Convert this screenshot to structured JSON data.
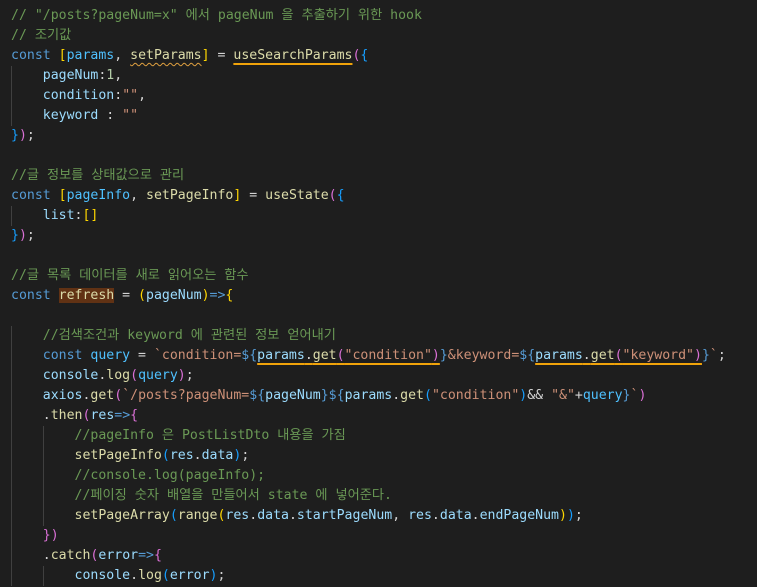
{
  "colors": {
    "background": "#1e1e1e",
    "highlight_underline": "#f0a30a",
    "squiggle": "#e0a040",
    "selection": "#613214"
  },
  "code_lines": [
    {
      "indent": 0,
      "tokens": [
        [
          "// \"/posts?pageNum=x\" 에서 pageNum 을 추출하기 위한 hook",
          "#6a9955"
        ]
      ]
    },
    {
      "indent": 0,
      "tokens": [
        [
          "// 조기값",
          "#6a9955"
        ]
      ]
    },
    {
      "indent": 0,
      "tokens": [
        [
          "const ",
          "#569cd6"
        ],
        [
          "[",
          "#ffd700"
        ],
        [
          "params",
          "#4fc1ff"
        ],
        [
          ", ",
          "#d4d4d4"
        ],
        [
          "setParams",
          "#dcdcaa",
          "squig"
        ],
        [
          "]",
          "#ffd700"
        ],
        [
          " = ",
          "#d4d4d4"
        ],
        [
          "useSearchParams",
          "#dcdcaa",
          "hl"
        ],
        [
          "(",
          "#da70d6"
        ],
        [
          "{",
          "#179fff"
        ]
      ]
    },
    {
      "indent": 1,
      "tokens": [
        [
          "pageNum",
          "#9cdcfe"
        ],
        [
          ":",
          "#d4d4d4"
        ],
        [
          "1",
          "#b5cea8"
        ],
        [
          ",",
          "#d4d4d4"
        ]
      ]
    },
    {
      "indent": 1,
      "tokens": [
        [
          "condition",
          "#9cdcfe"
        ],
        [
          ":",
          "#d4d4d4"
        ],
        [
          "\"\"",
          "#ce9178"
        ],
        [
          ",",
          "#d4d4d4"
        ]
      ]
    },
    {
      "indent": 1,
      "tokens": [
        [
          "keyword",
          "#9cdcfe"
        ],
        [
          " : ",
          "#d4d4d4"
        ],
        [
          "\"\"",
          "#ce9178"
        ]
      ]
    },
    {
      "indent": 0,
      "tokens": [
        [
          "}",
          "#179fff"
        ],
        [
          ")",
          "#da70d6"
        ],
        [
          ";",
          "#d4d4d4"
        ]
      ]
    },
    {
      "indent": 0,
      "tokens": []
    },
    {
      "indent": 0,
      "tokens": [
        [
          "//글 정보를 상태값으로 관리",
          "#6a9955"
        ]
      ]
    },
    {
      "indent": 0,
      "tokens": [
        [
          "const ",
          "#569cd6"
        ],
        [
          "[",
          "#ffd700"
        ],
        [
          "pageInfo",
          "#4fc1ff"
        ],
        [
          ", ",
          "#d4d4d4"
        ],
        [
          "setPageInfo",
          "#dcdcaa"
        ],
        [
          "]",
          "#ffd700"
        ],
        [
          " = ",
          "#d4d4d4"
        ],
        [
          "useState",
          "#dcdcaa"
        ],
        [
          "(",
          "#da70d6"
        ],
        [
          "{",
          "#179fff"
        ]
      ]
    },
    {
      "indent": 1,
      "tokens": [
        [
          "list",
          "#9cdcfe"
        ],
        [
          ":",
          "#d4d4d4"
        ],
        [
          "[]",
          "#ffd700"
        ]
      ]
    },
    {
      "indent": 0,
      "tokens": [
        [
          "}",
          "#179fff"
        ],
        [
          ")",
          "#da70d6"
        ],
        [
          ";",
          "#d4d4d4"
        ]
      ]
    },
    {
      "indent": 0,
      "tokens": []
    },
    {
      "indent": 0,
      "tokens": [
        [
          "//글 목록 데이터를 새로 읽어오는 함수",
          "#6a9955"
        ]
      ]
    },
    {
      "indent": 0,
      "tokens": [
        [
          "const ",
          "#569cd6"
        ],
        [
          "refresh",
          "#dcdcaa",
          "sel"
        ],
        [
          " = ",
          "#d4d4d4"
        ],
        [
          "(",
          "#ffd700"
        ],
        [
          "pageNum",
          "#9cdcfe"
        ],
        [
          ")",
          "#ffd700"
        ],
        [
          "=>",
          "#569cd6"
        ],
        [
          "{",
          "#ffd700"
        ]
      ]
    },
    {
      "indent": 0,
      "tokens": []
    },
    {
      "indent": 1,
      "tokens": [
        [
          "//검색조건과 keyword 에 관련된 정보 얻어내기",
          "#6a9955"
        ]
      ]
    },
    {
      "indent": 1,
      "tokens": [
        [
          "const ",
          "#569cd6"
        ],
        [
          "query",
          "#4fc1ff"
        ],
        [
          " = ",
          "#d4d4d4"
        ],
        [
          "`condition=",
          "#ce9178"
        ],
        [
          "${",
          "#569cd6"
        ],
        [
          "params",
          "#9cdcfe",
          "hl"
        ],
        [
          ".",
          "#d4d4d4",
          "hl"
        ],
        [
          "get",
          "#dcdcaa",
          "hl"
        ],
        [
          "(",
          "#da70d6",
          "hl"
        ],
        [
          "\"condition\"",
          "#ce9178",
          "hl"
        ],
        [
          ")",
          "#da70d6",
          "hl"
        ],
        [
          "}",
          "#569cd6"
        ],
        [
          "&keyword=",
          "#ce9178"
        ],
        [
          "${",
          "#569cd6"
        ],
        [
          "params",
          "#9cdcfe",
          "hl"
        ],
        [
          ".",
          "#d4d4d4",
          "hl"
        ],
        [
          "get",
          "#dcdcaa",
          "hl"
        ],
        [
          "(",
          "#da70d6",
          "hl"
        ],
        [
          "\"keyword\"",
          "#ce9178",
          "hl"
        ],
        [
          ")",
          "#da70d6",
          "hl"
        ],
        [
          "}",
          "#569cd6"
        ],
        [
          "`",
          "#ce9178"
        ],
        [
          ";",
          "#d4d4d4"
        ]
      ]
    },
    {
      "indent": 1,
      "tokens": [
        [
          "console",
          "#9cdcfe"
        ],
        [
          ".",
          "#d4d4d4"
        ],
        [
          "log",
          "#dcdcaa"
        ],
        [
          "(",
          "#da70d6"
        ],
        [
          "query",
          "#4fc1ff"
        ],
        [
          ")",
          "#da70d6"
        ],
        [
          ";",
          "#d4d4d4"
        ]
      ]
    },
    {
      "indent": 1,
      "tokens": [
        [
          "axios",
          "#9cdcfe"
        ],
        [
          ".",
          "#d4d4d4"
        ],
        [
          "get",
          "#dcdcaa"
        ],
        [
          "(",
          "#da70d6"
        ],
        [
          "`/posts?pageNum=",
          "#ce9178"
        ],
        [
          "${",
          "#569cd6"
        ],
        [
          "pageNum",
          "#9cdcfe"
        ],
        [
          "}",
          "#569cd6"
        ],
        [
          "${",
          "#569cd6"
        ],
        [
          "params",
          "#9cdcfe"
        ],
        [
          ".",
          "#d4d4d4"
        ],
        [
          "get",
          "#dcdcaa"
        ],
        [
          "(",
          "#179fff"
        ],
        [
          "\"condition\"",
          "#ce9178"
        ],
        [
          ")",
          "#179fff"
        ],
        [
          "&& ",
          "#d4d4d4"
        ],
        [
          "\"&\"",
          "#ce9178"
        ],
        [
          "+",
          "#d4d4d4"
        ],
        [
          "query",
          "#4fc1ff"
        ],
        [
          "}",
          "#569cd6"
        ],
        [
          "`",
          "#ce9178"
        ],
        [
          ")",
          "#da70d6"
        ]
      ]
    },
    {
      "indent": 1,
      "tokens": [
        [
          ".",
          "#d4d4d4"
        ],
        [
          "then",
          "#dcdcaa"
        ],
        [
          "(",
          "#da70d6"
        ],
        [
          "res",
          "#9cdcfe"
        ],
        [
          "=>",
          "#569cd6"
        ],
        [
          "{",
          "#da70d6"
        ]
      ]
    },
    {
      "indent": 2,
      "tokens": [
        [
          "//pageInfo 은 PostListDto 내용을 가짐",
          "#6a9955"
        ]
      ]
    },
    {
      "indent": 2,
      "tokens": [
        [
          "setPageInfo",
          "#dcdcaa"
        ],
        [
          "(",
          "#179fff"
        ],
        [
          "res",
          "#9cdcfe"
        ],
        [
          ".",
          "#d4d4d4"
        ],
        [
          "data",
          "#9cdcfe"
        ],
        [
          ")",
          "#179fff"
        ],
        [
          ";",
          "#d4d4d4"
        ]
      ]
    },
    {
      "indent": 2,
      "tokens": [
        [
          "//console.log(pageInfo);",
          "#6a9955"
        ]
      ]
    },
    {
      "indent": 2,
      "tokens": [
        [
          "//페이징 숫자 배열을 만들어서 state 에 넣어준다.",
          "#6a9955"
        ]
      ]
    },
    {
      "indent": 2,
      "tokens": [
        [
          "setPageArray",
          "#dcdcaa"
        ],
        [
          "(",
          "#179fff"
        ],
        [
          "range",
          "#dcdcaa"
        ],
        [
          "(",
          "#ffd700"
        ],
        [
          "res",
          "#9cdcfe"
        ],
        [
          ".",
          "#d4d4d4"
        ],
        [
          "data",
          "#9cdcfe"
        ],
        [
          ".",
          "#d4d4d4"
        ],
        [
          "startPageNum",
          "#9cdcfe"
        ],
        [
          ", ",
          "#d4d4d4"
        ],
        [
          "res",
          "#9cdcfe"
        ],
        [
          ".",
          "#d4d4d4"
        ],
        [
          "data",
          "#9cdcfe"
        ],
        [
          ".",
          "#d4d4d4"
        ],
        [
          "endPageNum",
          "#9cdcfe"
        ],
        [
          ")",
          "#ffd700"
        ],
        [
          ")",
          "#179fff"
        ],
        [
          ";",
          "#d4d4d4"
        ]
      ]
    },
    {
      "indent": 1,
      "tokens": [
        [
          "}",
          "#da70d6"
        ],
        [
          ")",
          "#da70d6"
        ]
      ]
    },
    {
      "indent": 1,
      "tokens": [
        [
          ".",
          "#d4d4d4"
        ],
        [
          "catch",
          "#dcdcaa"
        ],
        [
          "(",
          "#da70d6"
        ],
        [
          "error",
          "#9cdcfe"
        ],
        [
          "=>",
          "#569cd6"
        ],
        [
          "{",
          "#da70d6"
        ]
      ]
    },
    {
      "indent": 2,
      "tokens": [
        [
          "console",
          "#9cdcfe"
        ],
        [
          ".",
          "#d4d4d4"
        ],
        [
          "log",
          "#dcdcaa"
        ],
        [
          "(",
          "#179fff"
        ],
        [
          "error",
          "#9cdcfe"
        ],
        [
          ")",
          "#179fff"
        ],
        [
          ";",
          "#d4d4d4"
        ]
      ]
    }
  ]
}
